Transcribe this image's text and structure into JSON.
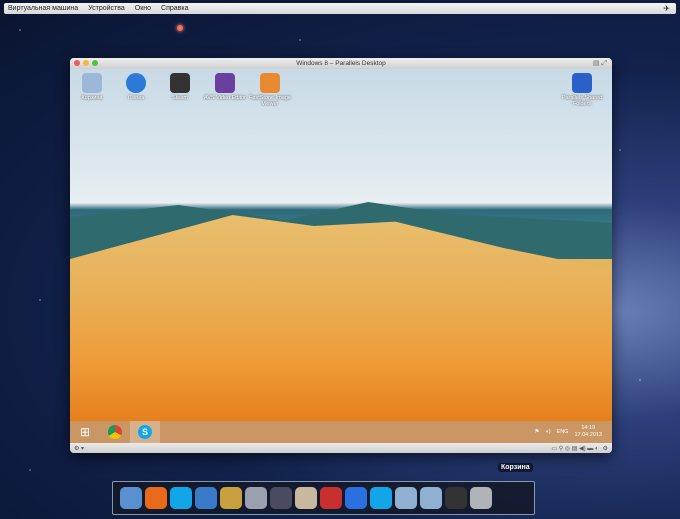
{
  "menubar": {
    "items": [
      "Виртуальная машина",
      "Устройства",
      "Окно",
      "Справка"
    ]
  },
  "window": {
    "title": "Windows 8 – Parallels Desktop"
  },
  "desktop_icons": [
    {
      "label": "Корзина",
      "color": "#9bb8d8"
    },
    {
      "label": "iTunes",
      "color": "#2b7ad8"
    },
    {
      "label": "Steam",
      "color": "#333333"
    },
    {
      "label": "AVS Video Editor",
      "color": "#6a3fa0"
    },
    {
      "label": "FastStone Image Viewer",
      "color": "#e88a30"
    },
    {
      "label": "Parallels Shared Folders",
      "color": "#2a60c8"
    }
  ],
  "taskbar": {
    "tray_lang": "ENG",
    "time": "14:19",
    "date": "17.04.2013"
  },
  "dock": {
    "tooltip": "Корзина",
    "items": [
      {
        "name": "finder",
        "color": "#5a8fd0"
      },
      {
        "name": "firefox",
        "color": "#e86a1a"
      },
      {
        "name": "skype",
        "color": "#12a5e8"
      },
      {
        "name": "itunes",
        "color": "#3a7ac8"
      },
      {
        "name": "cocktail",
        "color": "#c8a040"
      },
      {
        "name": "aperture",
        "color": "#9aa0b0"
      },
      {
        "name": "final-cut",
        "color": "#4a4a60"
      },
      {
        "name": "photo-app",
        "color": "#c8b8a0"
      },
      {
        "name": "parallels-vm",
        "color": "#c83030"
      },
      {
        "name": "system-preferences",
        "color": "#2a70e0"
      },
      {
        "name": "skype-parallels",
        "color": "#12a5e8"
      },
      {
        "name": "applications-folder",
        "color": "#8fb0d0"
      },
      {
        "name": "documents-folder",
        "color": "#8fb0d0"
      },
      {
        "name": "windows-folder",
        "color": "#333333"
      },
      {
        "name": "trash",
        "color": "#b0b4b8"
      }
    ]
  }
}
